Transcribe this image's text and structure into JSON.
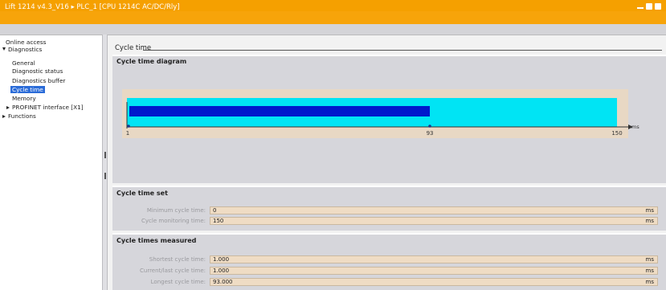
{
  "window": {
    "title": "Lift 1214 v4.3_V16 ▸ PLC_1 [CPU 1214C AC/DC/Rly]"
  },
  "nav": {
    "items": [
      {
        "label": "Online access"
      },
      {
        "label": "Diagnostics"
      },
      {
        "label": "General"
      },
      {
        "label": "Diagnostic status"
      },
      {
        "label": "Diagnostics buffer"
      },
      {
        "label": "Cycle time"
      },
      {
        "label": "Memory"
      },
      {
        "label": "PROFINET interface [X1]"
      },
      {
        "label": "Functions"
      }
    ]
  },
  "section": {
    "title": "Cycle time"
  },
  "diagram": {
    "title": "Cycle time diagram",
    "axis_min_label": "1",
    "current_label": "93",
    "axis_max_label": "150",
    "unit": "ms",
    "axis_min": 1,
    "axis_max": 150,
    "current_value": 93,
    "colors": {
      "frame": "#e8d8c4",
      "monitoring_area": "#00e4f4",
      "cycle_bar": "#0018cc"
    }
  },
  "cycle_time_set": {
    "title": "Cycle time set",
    "min_label": "Minimum cycle time:",
    "min_value": "0",
    "min_unit": "ms",
    "mon_label": "Cycle monitoring time:",
    "mon_value": "150",
    "mon_unit": "ms"
  },
  "cycle_times_measured": {
    "title": "Cycle times measured",
    "shortest_label": "Shortest cycle time:",
    "shortest_value": "1.000",
    "shortest_unit": "ms",
    "current_label": "Current/last cycle time:",
    "current_value": "1.000",
    "current_unit": "ms",
    "longest_label": "Longest cycle time:",
    "longest_value": "93.000",
    "longest_unit": "ms"
  }
}
